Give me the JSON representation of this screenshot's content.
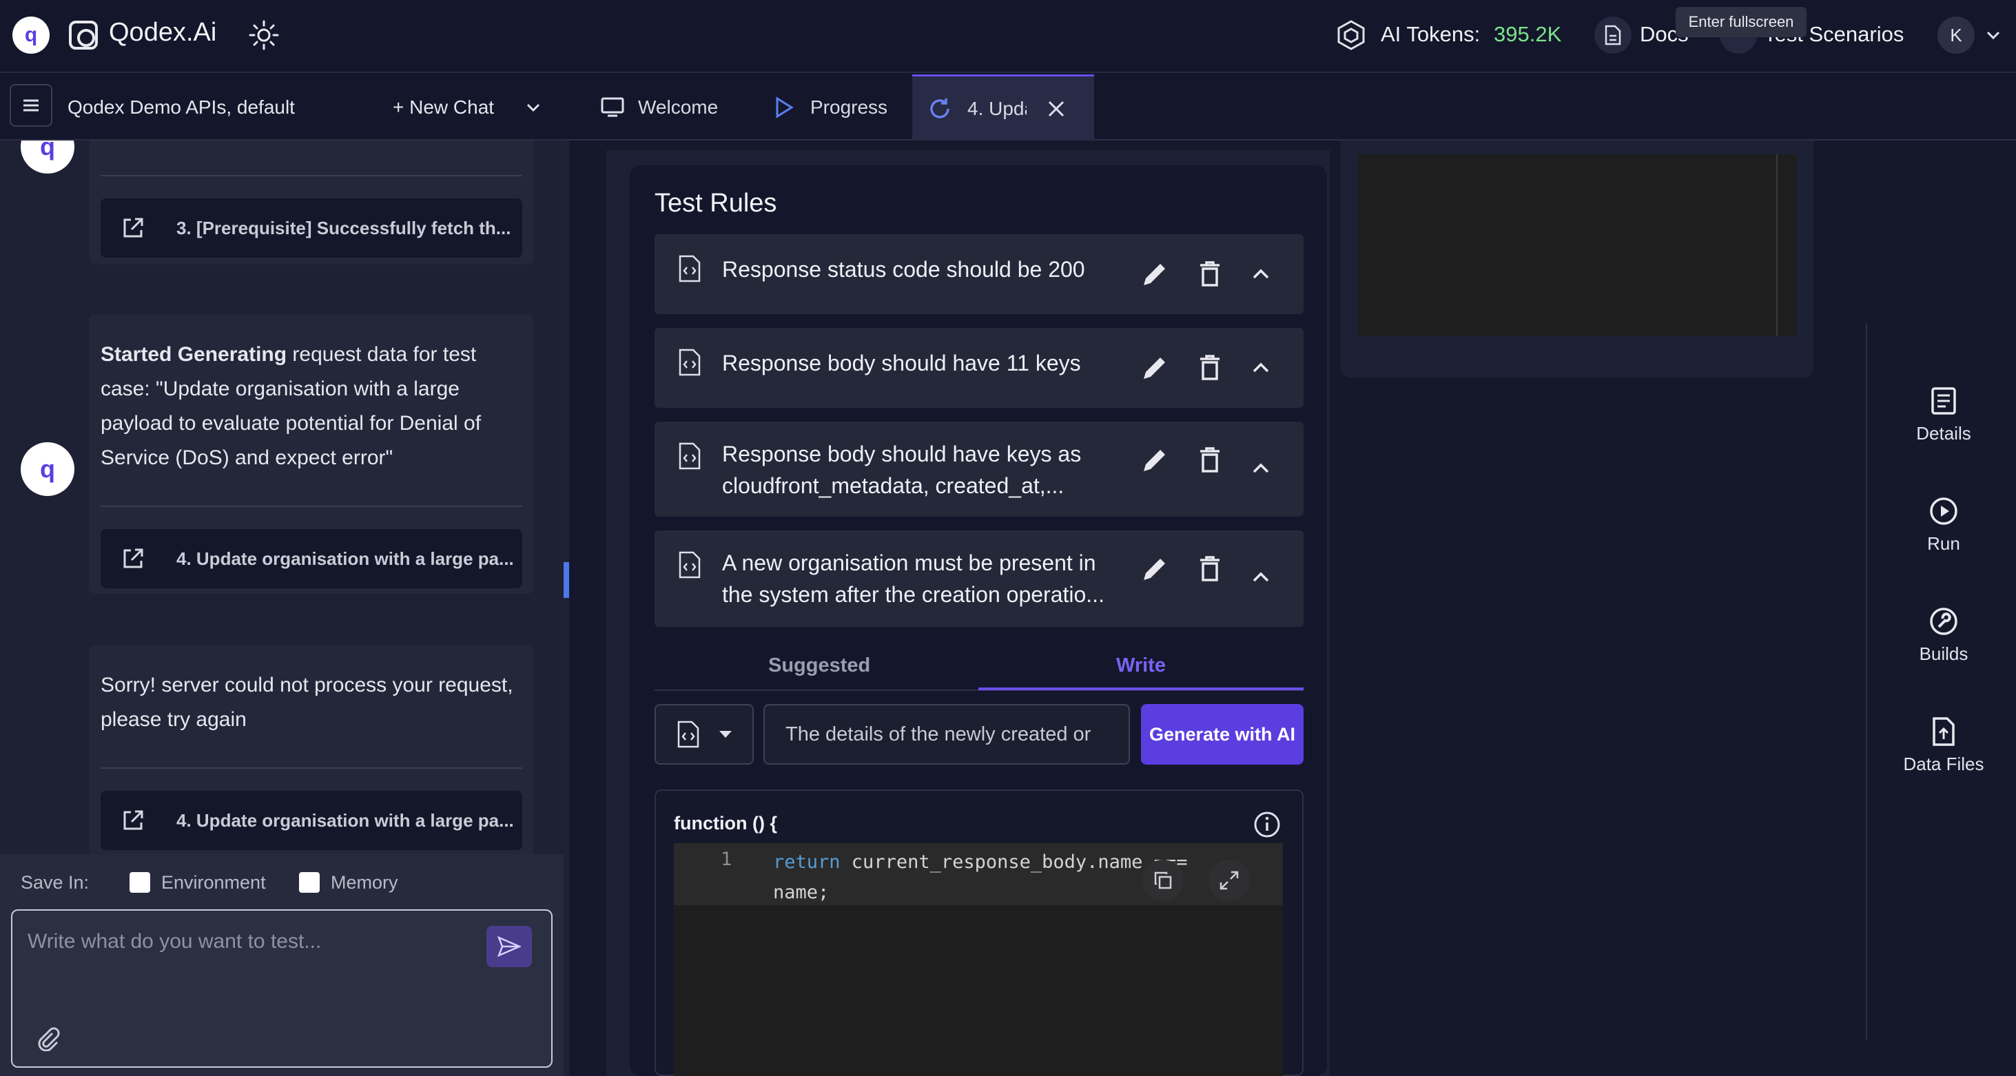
{
  "header": {
    "logo_letter": "q",
    "brand": "Qodex.Ai",
    "tokens_label": "AI Tokens:",
    "tokens_value": "395.2K",
    "docs_label": "Docs",
    "test_scenarios_label": "Test Scenarios",
    "tooltip": "Enter fullscreen",
    "avatar_initial": "K"
  },
  "sidebar": {
    "project": "Qodex Demo APIs, default",
    "new_chat": "+ New Chat",
    "messages": [
      {
        "link": "3. [Prerequisite] Successfully fetch th..."
      },
      {
        "bold": "Started Generating",
        "text": " request data for test case: \"Update organisation with a large payload to evaluate potential for Denial of Service (DoS) and expect error\"",
        "link": "4. Update organisation with a large pa..."
      },
      {
        "text": "Sorry! server could not process your request, please try again",
        "link": "4. Update organisation with a large pa..."
      }
    ],
    "save_in": "Save In:",
    "opt_environment": "Environment",
    "opt_memory": "Memory",
    "input_placeholder": "Write what do you want to test..."
  },
  "tabs": [
    {
      "label": "Welcome",
      "icon": "monitor-icon"
    },
    {
      "label": "Progress",
      "icon": "play-icon"
    },
    {
      "label": "4. Upda",
      "icon": "refresh-icon",
      "active": true
    }
  ],
  "test_rules": {
    "title": "Test Rules",
    "rules": [
      {
        "text": "Response status code should be 200"
      },
      {
        "text": "Response body should have 11 keys"
      },
      {
        "text": "Response body should have keys as cloudfront_metadata, created_at,..."
      },
      {
        "text": "A new organisation must be present in the system after the creation operatio..."
      }
    ],
    "subtabs": {
      "suggested": "Suggested",
      "write": "Write",
      "active": "Write"
    },
    "rule_input_value": "The details of the newly created or",
    "generate_button": "Generate with AI",
    "function_signature": "function () {",
    "code_line_number": "1",
    "code_keyword": "return",
    "code_rest": " current_response_body.name === name;"
  },
  "right_sidebar": {
    "details": "Details",
    "run": "Run",
    "builds": "Builds",
    "data_files": "Data Files"
  },
  "colors": {
    "accent": "#5b3ee0",
    "tokens": "#7be389",
    "background": "#12152a"
  }
}
